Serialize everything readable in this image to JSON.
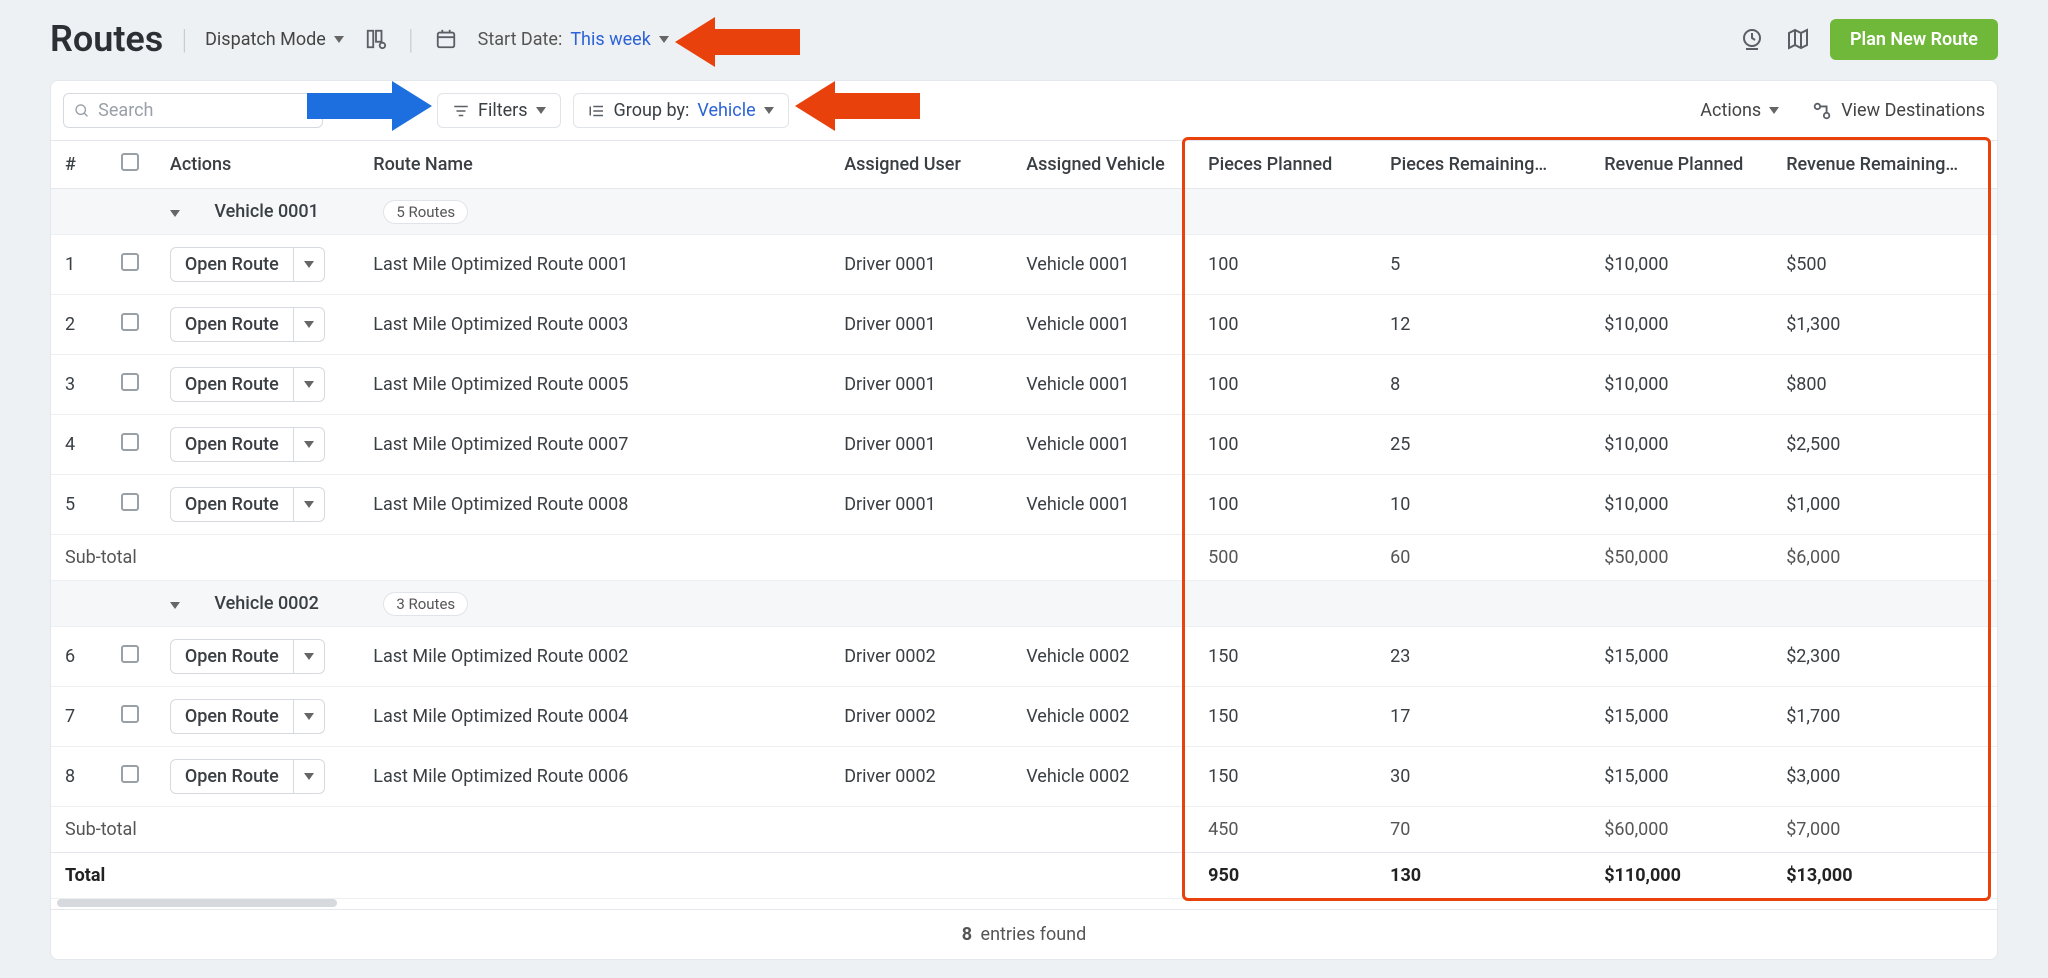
{
  "header": {
    "title": "Routes",
    "dispatch_mode_label": "Dispatch Mode",
    "start_date_prefix": "Start Date:",
    "start_date_value": "This week",
    "plan_button": "Plan New Route"
  },
  "toolbar": {
    "search_placeholder": "Search",
    "filters_label": "Filters",
    "group_by_prefix": "Group by:",
    "group_by_value": "Vehicle",
    "actions_label": "Actions",
    "view_dest_label": "View Destinations"
  },
  "columns": {
    "num": "#",
    "actions": "Actions",
    "route_name": "Route Name",
    "assigned_user": "Assigned User",
    "assigned_vehicle": "Assigned Vehicle",
    "pieces_planned": "Pieces Planned",
    "pieces_remaining": "Pieces Remaining…",
    "revenue_planned": "Revenue Planned",
    "revenue_remaining": "Revenue Remaining…"
  },
  "open_route_label": "Open Route",
  "groups": [
    {
      "name": "Vehicle 0001",
      "badge": "5 Routes",
      "rows": [
        {
          "n": "1",
          "route": "Last Mile Optimized Route 0001",
          "user": "Driver 0001",
          "veh": "Vehicle 0001",
          "pp": "100",
          "pr": "5",
          "revp": "$10,000",
          "revr": "$500"
        },
        {
          "n": "2",
          "route": "Last Mile Optimized Route 0003",
          "user": "Driver 0001",
          "veh": "Vehicle 0001",
          "pp": "100",
          "pr": "12",
          "revp": "$10,000",
          "revr": "$1,300"
        },
        {
          "n": "3",
          "route": "Last Mile Optimized Route 0005",
          "user": "Driver 0001",
          "veh": "Vehicle 0001",
          "pp": "100",
          "pr": "8",
          "revp": "$10,000",
          "revr": "$800"
        },
        {
          "n": "4",
          "route": "Last Mile Optimized Route 0007",
          "user": "Driver 0001",
          "veh": "Vehicle 0001",
          "pp": "100",
          "pr": "25",
          "revp": "$10,000",
          "revr": "$2,500"
        },
        {
          "n": "5",
          "route": "Last Mile Optimized Route 0008",
          "user": "Driver 0001",
          "veh": "Vehicle 0001",
          "pp": "100",
          "pr": "10",
          "revp": "$10,000",
          "revr": "$1,000"
        }
      ],
      "subtotal": {
        "label": "Sub-total",
        "pp": "500",
        "pr": "60",
        "revp": "$50,000",
        "revr": "$6,000"
      }
    },
    {
      "name": "Vehicle 0002",
      "badge": "3 Routes",
      "rows": [
        {
          "n": "6",
          "route": "Last Mile Optimized Route 0002",
          "user": "Driver 0002",
          "veh": "Vehicle 0002",
          "pp": "150",
          "pr": "23",
          "revp": "$15,000",
          "revr": "$2,300"
        },
        {
          "n": "7",
          "route": "Last Mile Optimized Route 0004",
          "user": "Driver 0002",
          "veh": "Vehicle 0002",
          "pp": "150",
          "pr": "17",
          "revp": "$15,000",
          "revr": "$1,700"
        },
        {
          "n": "8",
          "route": "Last Mile Optimized Route 0006",
          "user": "Driver 0002",
          "veh": "Vehicle 0002",
          "pp": "150",
          "pr": "30",
          "revp": "$15,000",
          "revr": "$3,000"
        }
      ],
      "subtotal": {
        "label": "Sub-total",
        "pp": "450",
        "pr": "70",
        "revp": "$60,000",
        "revr": "$7,000"
      }
    }
  ],
  "total": {
    "label": "Total",
    "pp": "950",
    "pr": "130",
    "revp": "$110,000",
    "revr": "$13,000"
  },
  "footer": {
    "count": "8",
    "suffix": "entries found"
  }
}
